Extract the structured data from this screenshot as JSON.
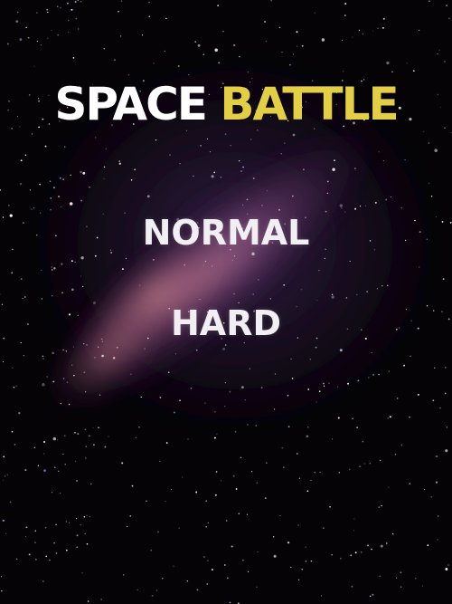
{
  "game": {
    "title_part_1": "SPACE",
    "title_part_2": "BATTLE"
  },
  "menu": {
    "options": [
      {
        "label": "NORMAL"
      },
      {
        "label": "HARD"
      }
    ]
  },
  "colors": {
    "background": "#050306",
    "title_white": "#ffffff",
    "title_yellow": "#e2cf45",
    "option_text": "#f2eff4"
  }
}
